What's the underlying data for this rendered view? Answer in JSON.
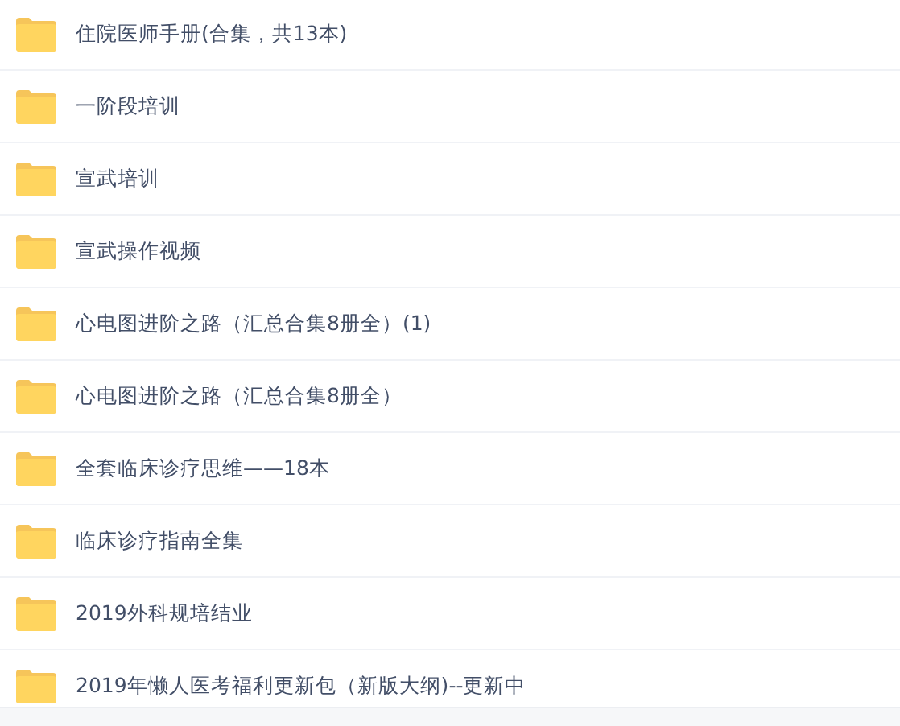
{
  "folders": [
    {
      "name": "住院医师手册(合集，共13本)"
    },
    {
      "name": "一阶段培训"
    },
    {
      "name": "宣武培训"
    },
    {
      "name": "宣武操作视频"
    },
    {
      "name": "心电图进阶之路（汇总合集8册全）(1)"
    },
    {
      "name": "心电图进阶之路（汇总合集8册全）"
    },
    {
      "name": "全套临床诊疗思维——18本"
    },
    {
      "name": "临床诊疗指南全集"
    },
    {
      "name": "2019外科规培结业"
    },
    {
      "name": "2019年懒人医考福利更新包（新版大纲)--更新中"
    }
  ]
}
